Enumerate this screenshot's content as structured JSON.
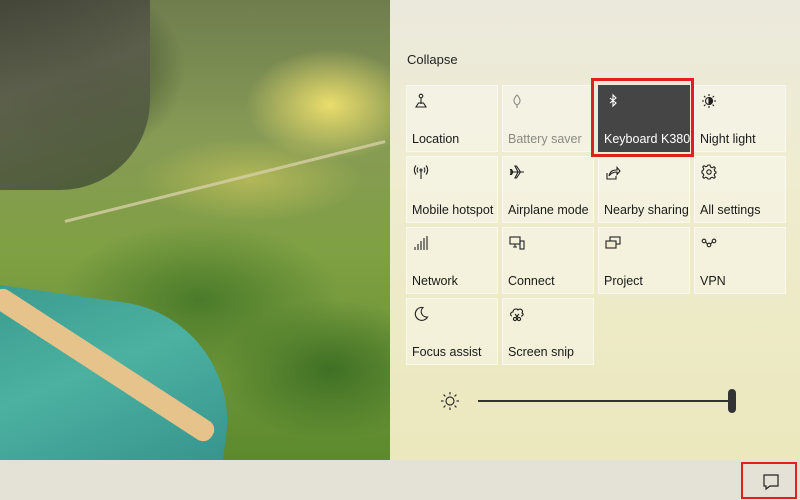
{
  "panel": {
    "collapse_label": "Collapse",
    "accent_highlight_color": "#e0201f"
  },
  "tiles": [
    {
      "label": "Location",
      "icon": "location-icon",
      "state": "off"
    },
    {
      "label": "Battery saver",
      "icon": "battery-saver-icon",
      "state": "disabled"
    },
    {
      "label": "Keyboard K380",
      "icon": "bluetooth-icon",
      "state": "on"
    },
    {
      "label": "Night light",
      "icon": "night-light-icon",
      "state": "off"
    },
    {
      "label": "Mobile hotspot",
      "icon": "mobile-hotspot-icon",
      "state": "off"
    },
    {
      "label": "Airplane mode",
      "icon": "airplane-icon",
      "state": "off"
    },
    {
      "label": "Nearby sharing",
      "icon": "nearby-sharing-icon",
      "state": "off"
    },
    {
      "label": "All settings",
      "icon": "gear-icon",
      "state": "off"
    },
    {
      "label": "Network",
      "icon": "network-icon",
      "state": "off"
    },
    {
      "label": "Connect",
      "icon": "connect-icon",
      "state": "off"
    },
    {
      "label": "Project",
      "icon": "project-icon",
      "state": "off"
    },
    {
      "label": "VPN",
      "icon": "vpn-icon",
      "state": "off"
    },
    {
      "label": "Focus assist",
      "icon": "moon-icon",
      "state": "off"
    },
    {
      "label": "Screen snip",
      "icon": "screen-snip-icon",
      "state": "off"
    }
  ],
  "brightness": {
    "icon": "brightness-icon",
    "level_percent": 100
  },
  "taskbar": {
    "notification_icon": "action-center-icon"
  }
}
